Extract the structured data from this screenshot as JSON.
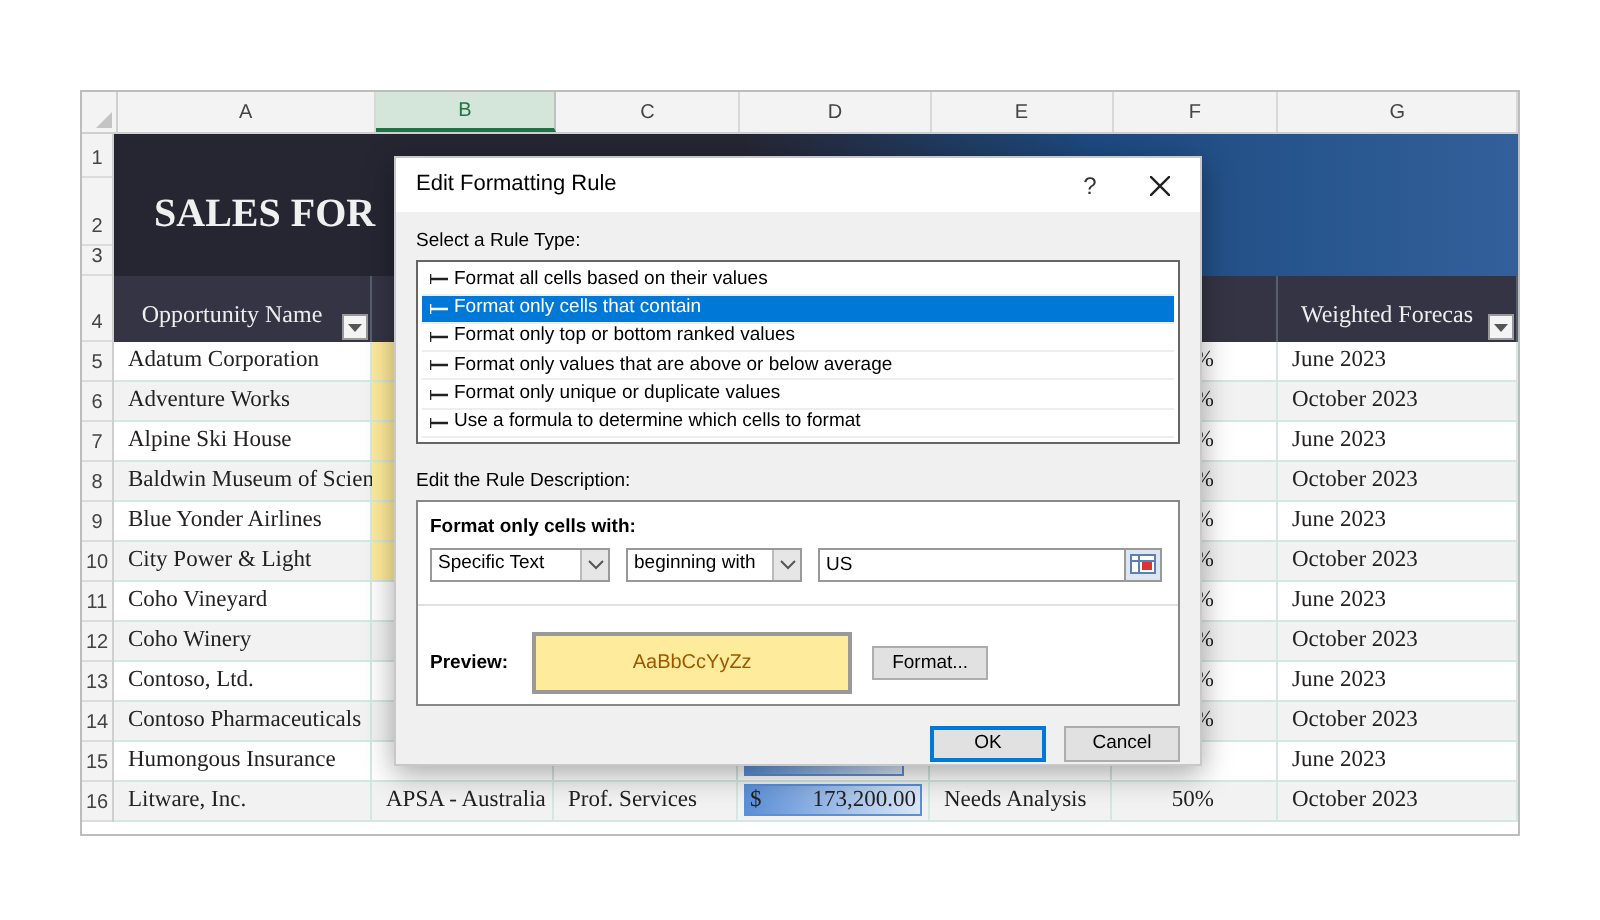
{
  "sheet": {
    "columns": [
      {
        "label": "A",
        "selected": false
      },
      {
        "label": "B",
        "selected": true
      },
      {
        "label": "C",
        "selected": false
      },
      {
        "label": "D",
        "selected": false
      },
      {
        "label": "E",
        "selected": false
      },
      {
        "label": "F",
        "selected": false
      },
      {
        "label": "G",
        "selected": false
      }
    ],
    "row_numbers": [
      "1",
      "2",
      "3",
      "4",
      "5",
      "6",
      "7",
      "8",
      "9",
      "10",
      "11",
      "12",
      "13",
      "14",
      "15",
      "16"
    ],
    "title": "SALES FOR",
    "header_row": {
      "a": "Opportunity Name",
      "g": "Weighted Forecas"
    },
    "rows": [
      {
        "a": "Adatum Corporation",
        "highlight": true,
        "f": "%",
        "g": "June 2023"
      },
      {
        "a": "Adventure Works",
        "highlight": true,
        "f": "%",
        "g": "October 2023"
      },
      {
        "a": "Alpine Ski House",
        "highlight": true,
        "f": "%",
        "g": "June 2023"
      },
      {
        "a": "Baldwin Museum of Scien",
        "highlight": true,
        "f": "%",
        "g": "October 2023"
      },
      {
        "a": "Blue Yonder Airlines",
        "highlight": true,
        "f": "%",
        "g": "June 2023"
      },
      {
        "a": "City Power & Light",
        "highlight": true,
        "f": "%",
        "g": "October 2023"
      },
      {
        "a": "Coho Vineyard",
        "highlight": false,
        "f": "%",
        "g": "June 2023"
      },
      {
        "a": "Coho Winery",
        "highlight": false,
        "f": "%",
        "g": "October 2023"
      },
      {
        "a": "Contoso, Ltd.",
        "highlight": false,
        "f": "%",
        "g": "June 2023"
      },
      {
        "a": "Contoso Pharmaceuticals",
        "highlight": false,
        "f": "%",
        "g": "October 2023"
      },
      {
        "a": "Humongous Insurance",
        "highlight": false,
        "level": 0.9,
        "g": "June 2023"
      },
      {
        "a": "Litware, Inc.",
        "highlight": false,
        "b": "APSA - Australia",
        "c": "Prof. Services",
        "currency": "$",
        "d": "173,200.00",
        "level": 1,
        "e": "Needs Analysis",
        "f": "50%",
        "g": "October 2023"
      }
    ]
  },
  "dialog": {
    "title": "Edit Formatting Rule",
    "help": "?",
    "rule_type_label": "Select a Rule Type:",
    "rule_types": [
      {
        "label": "Format all cells based on their values",
        "selected": false
      },
      {
        "label": "Format only cells that contain",
        "selected": true
      },
      {
        "label": "Format only top or bottom ranked values",
        "selected": false
      },
      {
        "label": "Format only values that are above or below average",
        "selected": false
      },
      {
        "label": "Format only unique or duplicate values",
        "selected": false
      },
      {
        "label": "Use a formula to determine which cells to format",
        "selected": false
      }
    ],
    "description_label": "Edit the Rule Description:",
    "condition_label": "Format only cells with:",
    "condition_type": "Specific Text",
    "operator": "beginning with",
    "value": "US",
    "preview_label": "Preview:",
    "preview_text": "AaBbCcYyZz",
    "format_button": "Format...",
    "buttons": [
      {
        "label": "OK",
        "default": true
      },
      {
        "label": "Cancel",
        "default": false
      }
    ]
  }
}
